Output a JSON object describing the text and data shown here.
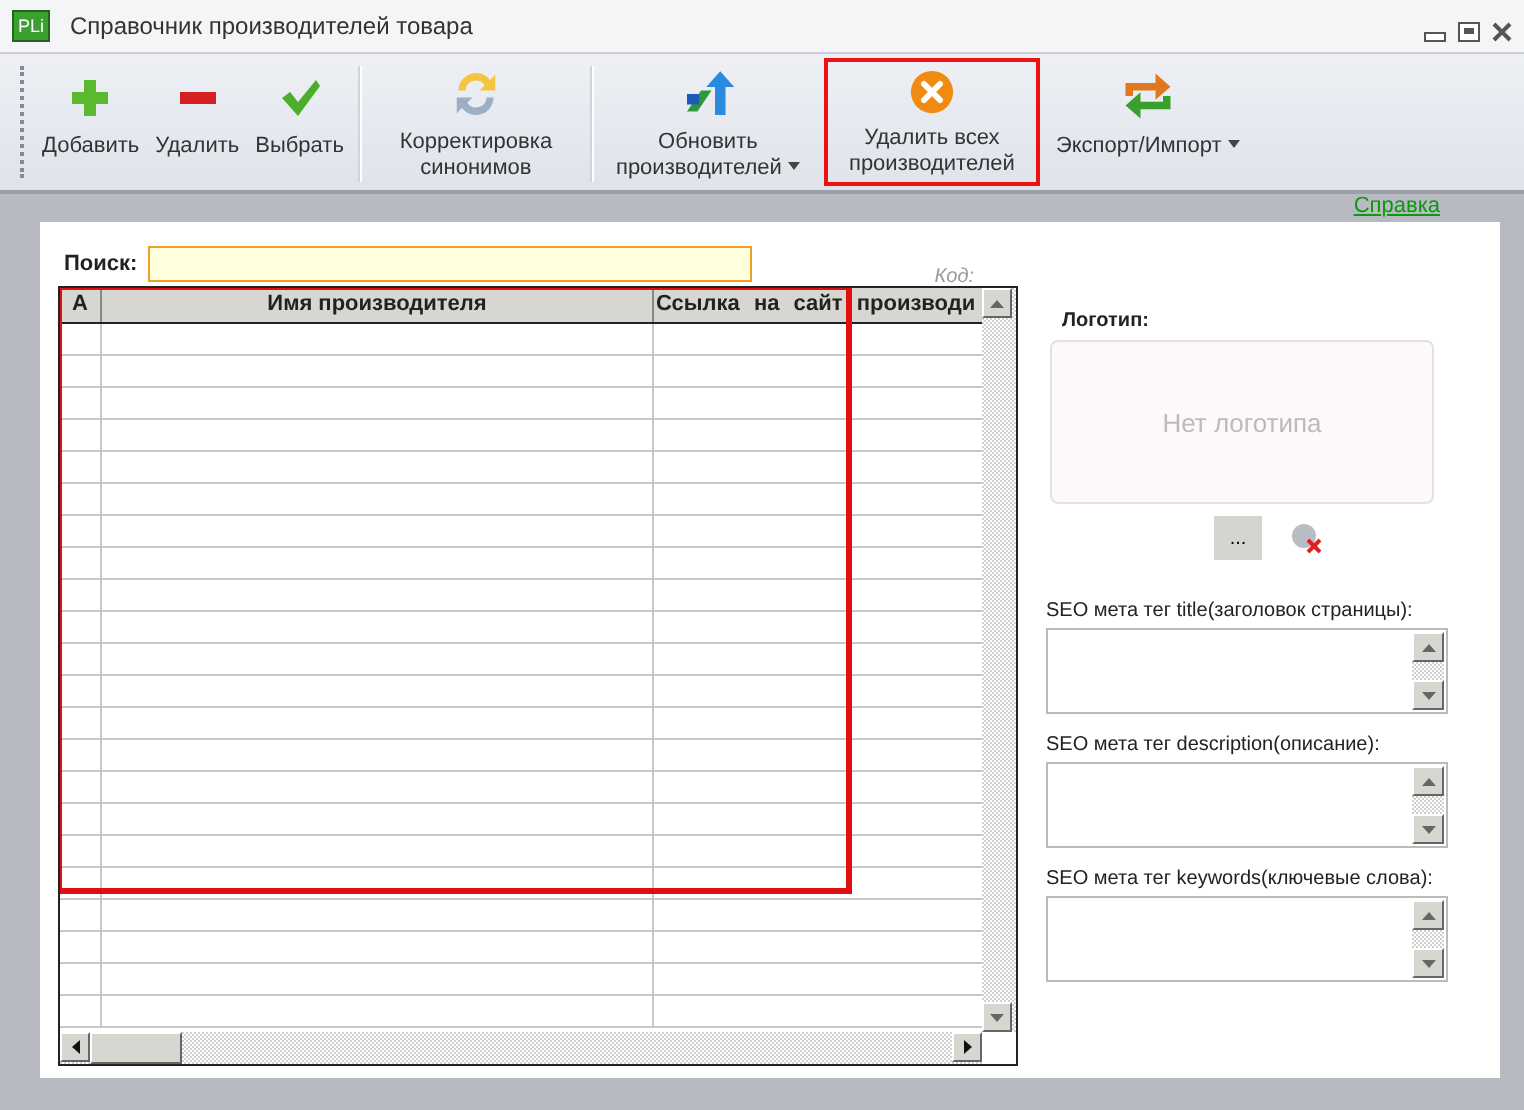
{
  "window": {
    "title": "Справочник производителей товара",
    "icon_text": "PLi"
  },
  "toolbar": [
    {
      "kind": "add",
      "label": "Добавить",
      "dropdown": false,
      "highlighted": false
    },
    {
      "kind": "remove",
      "label": "Удалить",
      "dropdown": false,
      "highlighted": false
    },
    {
      "kind": "select",
      "label": "Выбрать",
      "dropdown": false,
      "highlighted": false
    },
    {
      "kind": "sync",
      "label": "Корректировка синонимов",
      "dropdown": false,
      "highlighted": false,
      "separator_before": true
    },
    {
      "kind": "update",
      "label": "Обновить производителей",
      "dropdown": true,
      "highlighted": false,
      "separator_before": true
    },
    {
      "kind": "delete_all",
      "label": "Удалить всех производителей",
      "dropdown": false,
      "highlighted": true
    },
    {
      "kind": "exchange",
      "label": "Экспорт/Импорт",
      "dropdown": true,
      "highlighted": false
    }
  ],
  "help_link": "Справка",
  "search": {
    "label": "Поиск:"
  },
  "code_label": "Код:",
  "table": {
    "columns": [
      "А",
      "Имя производителя",
      "Ссылка на сайт производи"
    ],
    "highlighted": true
  },
  "logo": {
    "label": "Логотип:",
    "placeholder": "Нет логотипа",
    "browse_button": "..."
  },
  "seo_fields": [
    {
      "label": "SEO мета тег title(заголовок страницы):"
    },
    {
      "label": "SEO мета тег description(описание):"
    },
    {
      "label": "SEO мета тег keywords(ключевые слова):"
    }
  ]
}
